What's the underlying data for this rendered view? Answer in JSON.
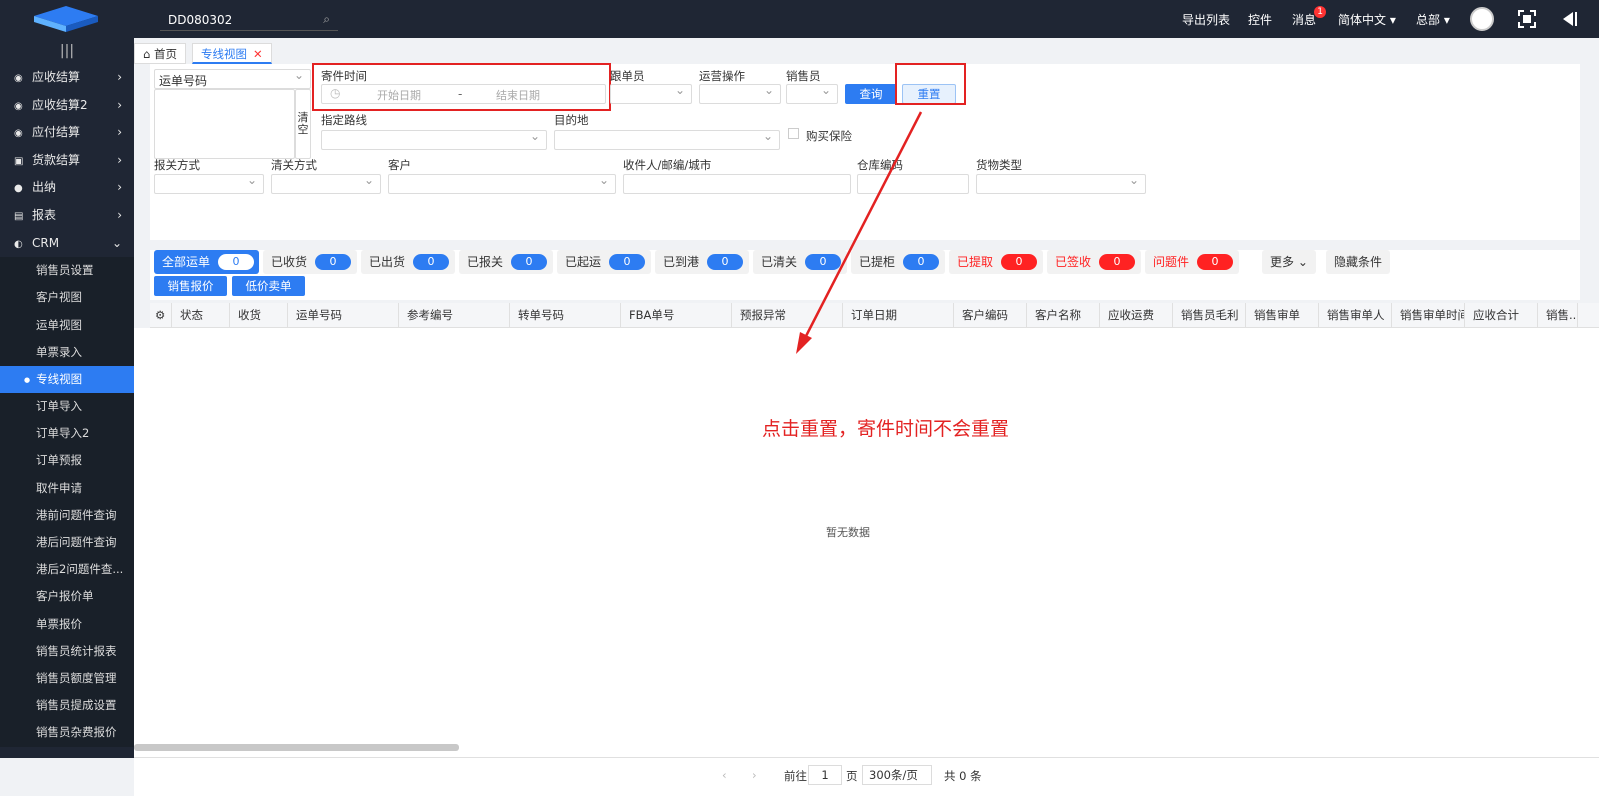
{
  "topbar": {
    "search_value": "DD080302",
    "items": [
      "导出列表",
      "控件",
      "消息",
      "简体中文",
      "总部"
    ],
    "message_badge": "1",
    "lang_arrow": "▾",
    "org_arrow": "▾"
  },
  "sidebar": {
    "collapse": "|||",
    "menu": [
      {
        "label": "应收结算",
        "icon": "coins-icon"
      },
      {
        "label": "应收结算2",
        "icon": "coins-icon"
      },
      {
        "label": "应付结算",
        "icon": "coins-icon"
      },
      {
        "label": "货款结算",
        "icon": "wallet-icon"
      },
      {
        "label": "出纳",
        "icon": "user-icon"
      },
      {
        "label": "报表",
        "icon": "report-icon"
      },
      {
        "label": "CRM",
        "icon": "pie-icon"
      }
    ],
    "sub": [
      "销售员设置",
      "客户视图",
      "运单视图",
      "单票录入",
      "专线视图",
      "订单导入",
      "订单导入2",
      "订单预报",
      "取件申请",
      "港前问题件查询",
      "港后问题件查询",
      "港后2问题件查...",
      "客户报价单",
      "单票报价",
      "销售员统计报表",
      "销售员额度管理",
      "销售员提成设置",
      "销售员杂费报价"
    ],
    "active_sub": "专线视图"
  },
  "tabs": {
    "home": "首页",
    "current": "专线视图",
    "close": "✕"
  },
  "filter": {
    "waybill_no": "运单号码",
    "clear": "清空",
    "send_time": "寄件时间",
    "start_date": "开始日期",
    "sep": "-",
    "end_date": "结束日期",
    "follower": "跟单员",
    "ops": "运营操作",
    "sales": "销售员",
    "query": "查询",
    "reset": "重置",
    "route": "指定路线",
    "destination": "目的地",
    "insurance": "购买保险",
    "customs_declare": "报关方式",
    "customs_clear": "清关方式",
    "customer": "客户",
    "receiver": "收件人/邮编/城市",
    "warehouse": "仓库编码",
    "goods_type": "货物类型"
  },
  "status_chips": [
    {
      "label": "全部运单",
      "count": "0",
      "style": "first"
    },
    {
      "label": "已收货",
      "count": "0",
      "style": "normal"
    },
    {
      "label": "已出货",
      "count": "0",
      "style": "normal"
    },
    {
      "label": "已报关",
      "count": "0",
      "style": "normal"
    },
    {
      "label": "已起运",
      "count": "0",
      "style": "normal"
    },
    {
      "label": "已到港",
      "count": "0",
      "style": "normal"
    },
    {
      "label": "已清关",
      "count": "0",
      "style": "normal"
    },
    {
      "label": "已提柜",
      "count": "0",
      "style": "normal"
    },
    {
      "label": "已提取",
      "count": "0",
      "style": "red"
    },
    {
      "label": "已签收",
      "count": "0",
      "style": "red"
    },
    {
      "label": "问题件",
      "count": "0",
      "style": "red"
    }
  ],
  "more": "更多",
  "hide_conditions": "隐藏条件",
  "sales_quote": "销售报价",
  "low_price_sale": "低价卖单",
  "columns": [
    "状态",
    "收货",
    "运单号码",
    "参考编号",
    "转单号码",
    "FBA单号",
    "预报异常",
    "订单日期",
    "客户编码",
    "客户名称",
    "应收运费",
    "销售员毛利",
    "销售审单",
    "销售审单人",
    "销售审单时间",
    "应收合计",
    "销售..."
  ],
  "empty_text": "暂无数据",
  "annotation": "点击重置，寄件时间不会重置",
  "pager": {
    "prev": "‹",
    "next": "›",
    "goto": "前往",
    "page": "1",
    "page_unit": "页",
    "page_size": "300条/页",
    "total": "共 0 条"
  },
  "colors": {
    "accent": "#2d7cf2",
    "annotation": "#e32222",
    "sidebar": "#1f2634"
  }
}
